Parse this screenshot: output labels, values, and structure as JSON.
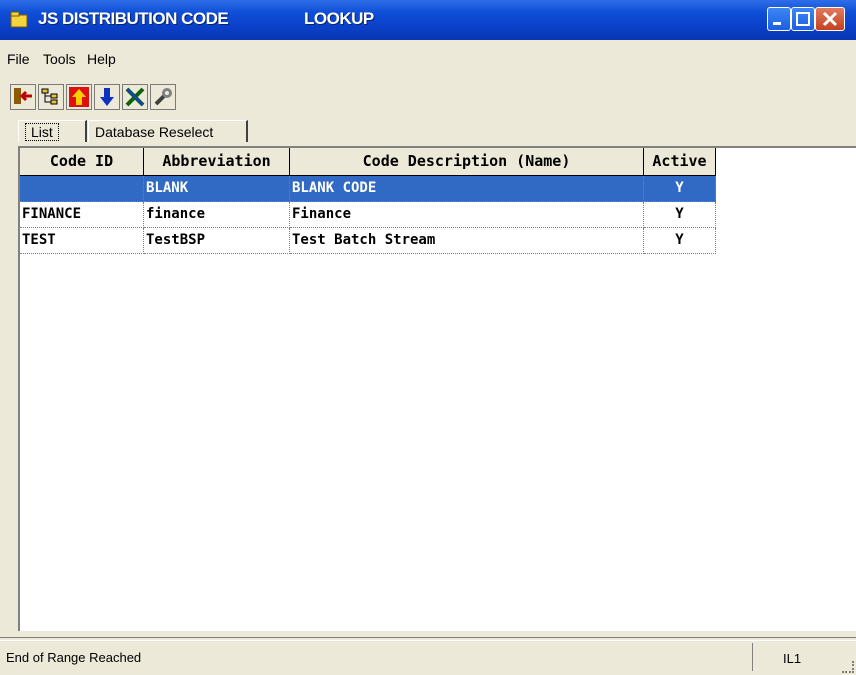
{
  "window": {
    "title_left": "JS DISTRIBUTION CODE",
    "title_right": "LOOKUP",
    "icon": "folder-app-icon"
  },
  "menu": [
    "File",
    "Tools",
    "Help"
  ],
  "toolbar": {
    "buttons": [
      "exit-icon",
      "tree-icon",
      "up-arrow-icon",
      "down-arrow-icon",
      "select-icon",
      "wrench-icon"
    ]
  },
  "tabs": [
    "List",
    "Database Reselect"
  ],
  "grid": {
    "columns": [
      "Code ID",
      "Abbreviation",
      "Code Description (Name)",
      "Active"
    ],
    "rows": [
      {
        "code_id": "",
        "abbreviation": "BLANK",
        "description": "BLANK CODE",
        "active": "Y",
        "selected": true
      },
      {
        "code_id": "FINANCE",
        "abbreviation": "finance",
        "description": "Finance",
        "active": "Y",
        "selected": false
      },
      {
        "code_id": "TEST",
        "abbreviation": "TestBSP",
        "description": "Test Batch Stream",
        "active": "Y",
        "selected": false
      }
    ]
  },
  "status": {
    "message": "End of Range Reached",
    "indicator": "IL1"
  },
  "colors": {
    "title_bar": "#0a3fc7",
    "selection": "#316ac5",
    "window_bg": "#ece9d8"
  }
}
